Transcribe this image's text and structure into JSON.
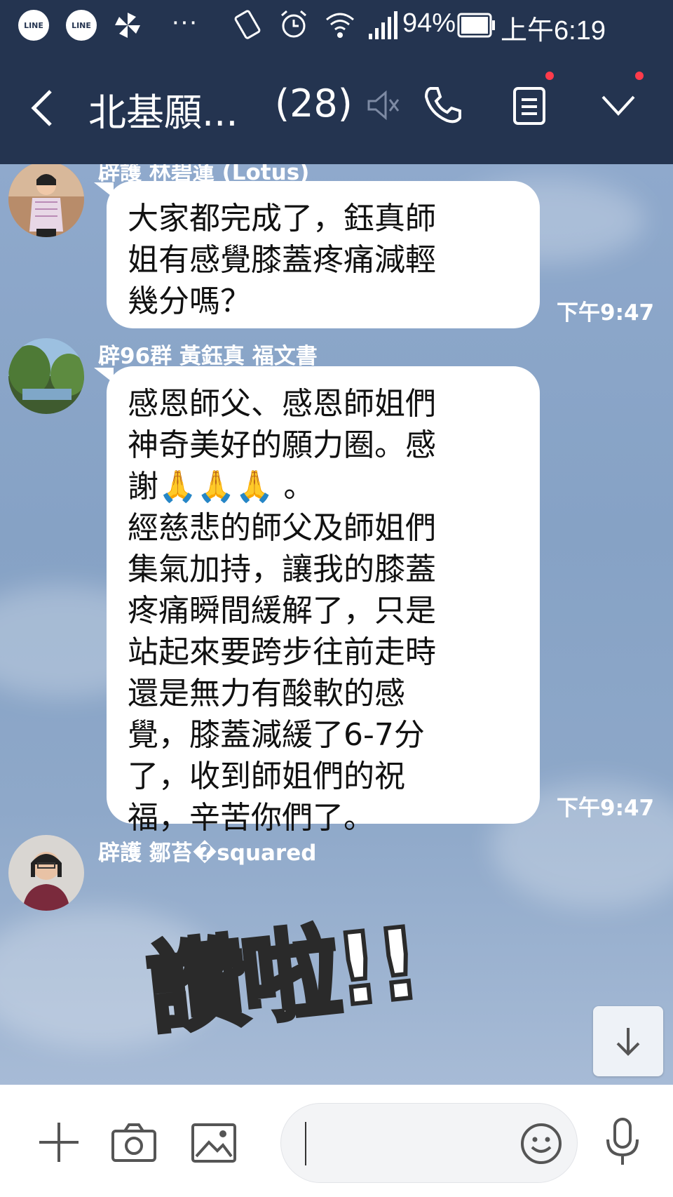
{
  "status_bar": {
    "notif_icons": [
      "line-app-icon",
      "line-app-icon",
      "pinwheel-icon"
    ],
    "line_badge": "LINE",
    "more": "···",
    "battery": "94%",
    "time": "上午6:19"
  },
  "header": {
    "title": "北基願...",
    "member_count": "(28)",
    "icons": [
      "back-chevron-icon",
      "mute-icon",
      "phone-icon",
      "notes-icon",
      "chevron-down-icon"
    ],
    "badge_color": "#ff3b4b"
  },
  "messages": [
    {
      "sender": "辟護 林碧蓮 (Lotus)",
      "text": "大家都完成了，鈺真師\n姐有感覺膝蓋疼痛減輕\n幾分嗎？",
      "time": "下午9:47"
    },
    {
      "sender": "辟96群 黃鈺真 福文書",
      "text": "感恩師父、感恩師姐們\n神奇美好的願力圈。感\n謝🙏🙏🙏 。\n經慈悲的師父及師姐們\n集氣加持，讓我的膝蓋\n疼痛瞬間緩解了，只是\n站起來要跨步往前走時\n還是無力有酸軟的感\n覺，膝蓋減緩了6-7分\n了，收到師姐們的祝\n福，辛苦你們了。",
      "time": "下午9:47"
    },
    {
      "sender": "辟護 鄒苔�squared",
      "sticker_text": "讚啦!!"
    }
  ],
  "input_bar": {
    "icons": [
      "plus-icon",
      "camera-icon",
      "image-icon",
      "emoji-icon",
      "microphone-icon"
    ],
    "placeholder": ""
  },
  "colors": {
    "header_bg": "#243450",
    "chat_bg": "#8aa6c8",
    "bubble_bg": "#ffffff"
  }
}
